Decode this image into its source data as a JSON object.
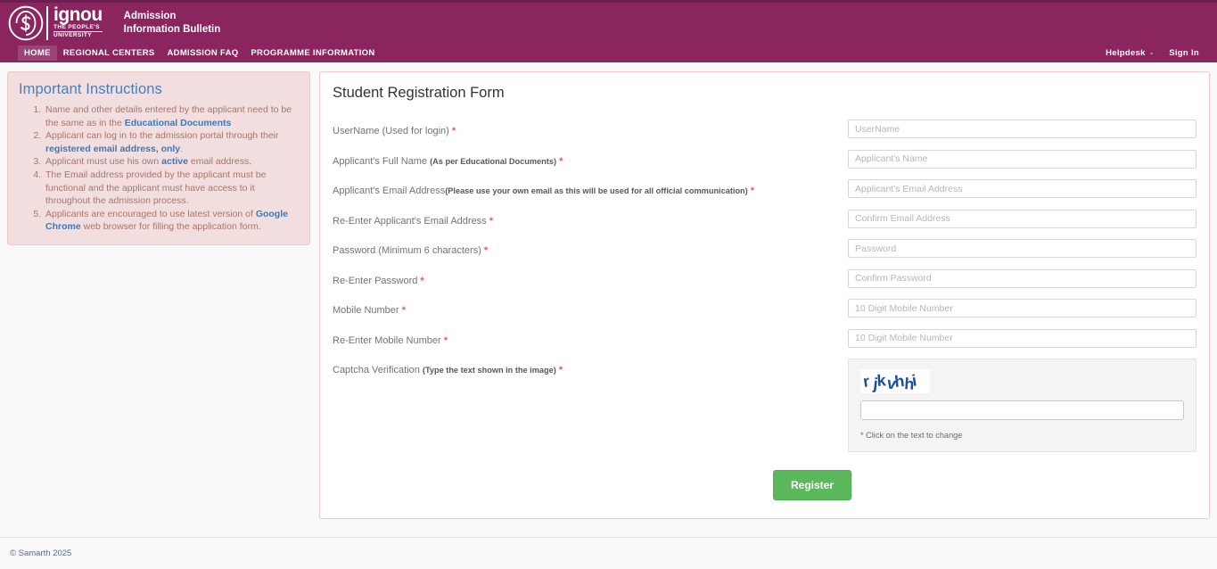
{
  "header": {
    "logo": {
      "wordmark": "ignou",
      "tagline_line1": "THE PEOPLE'S",
      "tagline_line2": "UNIVERSITY",
      "icon": "ignou-emblem-icon"
    },
    "title_line1": "Admission",
    "title_line2": "Information Bulletin",
    "accent_color": "#8a2560",
    "top_strip_color": "#6e1f4f"
  },
  "nav": {
    "items": [
      {
        "label": "HOME",
        "active": true
      },
      {
        "label": "REGIONAL CENTERS",
        "active": false
      },
      {
        "label": "ADMISSION FAQ",
        "active": false
      },
      {
        "label": "PROGRAMME INFORMATION",
        "active": false
      }
    ],
    "right_items": [
      {
        "label": "Helpdesk",
        "has_caret": true,
        "caret": "-"
      },
      {
        "label": "Sign In",
        "has_caret": false
      }
    ]
  },
  "instructions": {
    "title": "Important Instructions",
    "items": [
      {
        "parts": [
          {
            "text": "Name and other details entered by the applicant need to be the same as in the ",
            "highlight": false
          },
          {
            "text": "Educational Documents",
            "highlight": true
          }
        ]
      },
      {
        "parts": [
          {
            "text": "Applicant can log in to the admission portal through their ",
            "highlight": false
          },
          {
            "text": "registered email address, only",
            "highlight": true
          },
          {
            "text": ".",
            "highlight": false
          }
        ]
      },
      {
        "parts": [
          {
            "text": "Applicant must use his own ",
            "highlight": false
          },
          {
            "text": "active",
            "highlight": true
          },
          {
            "text": " email address.",
            "highlight": false
          }
        ]
      },
      {
        "parts": [
          {
            "text": "The Email address provided by the applicant must be functional and the applicant must have access to it throughout the admission process.",
            "highlight": false
          }
        ]
      },
      {
        "parts": [
          {
            "text": "Applicants are encouraged to use latest version of ",
            "highlight": false
          },
          {
            "text": "Google Chrome",
            "highlight": true
          },
          {
            "text": " web browser for filling the application form.",
            "highlight": false
          }
        ]
      }
    ]
  },
  "form": {
    "title": "Student Registration Form",
    "required_marker": "*",
    "fields": [
      {
        "label": "UserName (Used for login)",
        "sub": "",
        "required": true,
        "placeholder": "UserName",
        "value": "",
        "type": "text",
        "name": "username-input"
      },
      {
        "label": "Applicant's Full Name ",
        "sub": "(As per Educational Documents)",
        "required": true,
        "placeholder": "Applicant's Name",
        "value": "",
        "type": "text",
        "name": "full-name-input"
      },
      {
        "label": "Applicant's Email Address",
        "sub": "(Please use your own email as this will be used for all official communication)",
        "required": true,
        "placeholder": "Applicant's Email Address",
        "value": "",
        "type": "text",
        "name": "email-input"
      },
      {
        "label": "Re-Enter Applicant's Email Address",
        "sub": "",
        "required": true,
        "placeholder": "Confirm Email Address",
        "value": "",
        "type": "text",
        "name": "confirm-email-input"
      },
      {
        "label": "Password (Minimum 6 characters)",
        "sub": "",
        "required": true,
        "placeholder": "Password",
        "value": "",
        "type": "password",
        "name": "password-input"
      },
      {
        "label": "Re-Enter Password",
        "sub": "",
        "required": true,
        "placeholder": "Confirm Password",
        "value": "",
        "type": "password",
        "name": "confirm-password-input"
      },
      {
        "label": "Mobile Number",
        "sub": "",
        "required": true,
        "placeholder": "10 Digit Mobile Number",
        "value": "",
        "type": "text",
        "name": "mobile-input"
      },
      {
        "label": "Re-Enter Mobile Number",
        "sub": "",
        "required": true,
        "placeholder": "10 Digit Mobile Number",
        "value": "",
        "type": "text",
        "name": "confirm-mobile-input"
      }
    ],
    "captcha": {
      "label": "Captcha Verification ",
      "sub": "(Type the text shown in the image)",
      "required": true,
      "image_text": "rjkvhhi",
      "image_color": "#1a4fa0",
      "input_value": "",
      "input_placeholder": "",
      "note": "* Click on the text to change"
    },
    "submit_label": "Register",
    "submit_color": "#5cb85c"
  },
  "footer": {
    "copyright": "© Samarth 2025"
  }
}
